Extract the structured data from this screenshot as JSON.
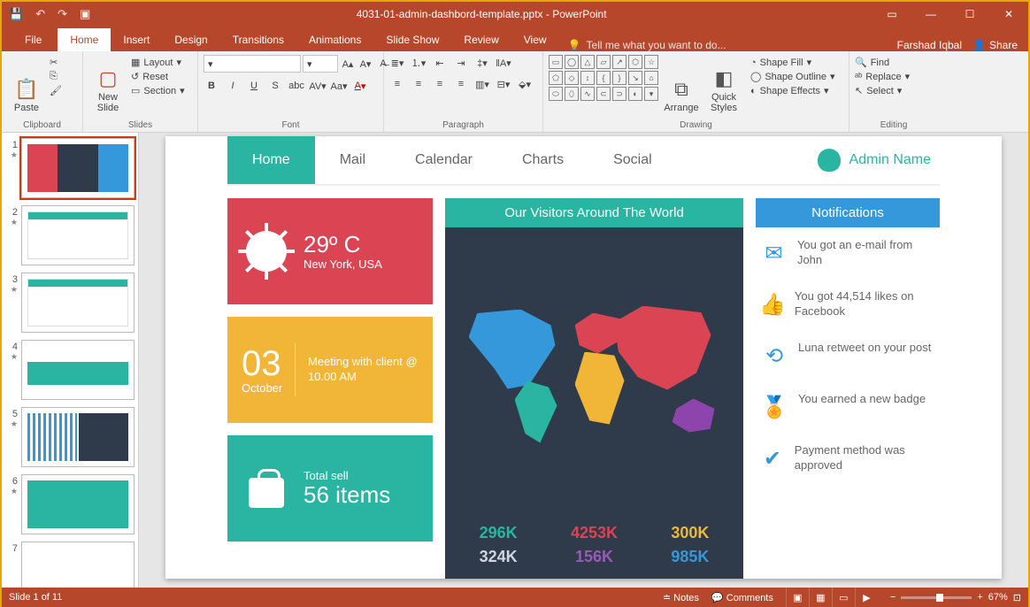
{
  "title": "4031-01-admin-dashbord-template.pptx - PowerPoint",
  "user": "Farshad Iqbal",
  "share": "Share",
  "ribbonTabs": {
    "file": "File",
    "home": "Home",
    "insert": "Insert",
    "design": "Design",
    "transitions": "Transitions",
    "animations": "Animations",
    "slideshow": "Slide Show",
    "review": "Review",
    "view": "View",
    "tell": "Tell me what you want to do..."
  },
  "groups": {
    "clipboard": {
      "label": "Clipboard",
      "paste": "Paste",
      "cut": "Cut",
      "copy": "Copy",
      "painter": "Format Painter"
    },
    "slides": {
      "label": "Slides",
      "new": "New\nSlide",
      "layout": "Layout",
      "reset": "Reset",
      "section": "Section"
    },
    "font": {
      "label": "Font"
    },
    "paragraph": {
      "label": "Paragraph"
    },
    "drawing": {
      "label": "Drawing",
      "arrange": "Arrange",
      "quick": "Quick\nStyles",
      "fill": "Shape Fill",
      "outline": "Shape Outline",
      "effects": "Shape Effects"
    },
    "editing": {
      "label": "Editing",
      "find": "Find",
      "replace": "Replace",
      "select": "Select"
    }
  },
  "thumbs": {
    "count": 11,
    "selected": 1
  },
  "slide": {
    "nav": {
      "home": "Home",
      "mail": "Mail",
      "calendar": "Calendar",
      "charts": "Charts",
      "social": "Social",
      "admin": "Admin Name"
    },
    "weather": {
      "temp": "29º C",
      "loc": "New York, USA"
    },
    "meeting": {
      "day": "03",
      "month": "October",
      "text": "Meeting with client @ 10.00 AM"
    },
    "sell": {
      "label": "Total sell",
      "value": "56 items"
    },
    "visitors": {
      "title": "Our Visitors Around The World",
      "stats": [
        "296K",
        "4253K",
        "300K",
        "324K",
        "156K",
        "985K"
      ]
    },
    "notifications": {
      "title": "Notifications",
      "items": [
        "You got an e-mail from John",
        "You got 44,514 likes on Facebook",
        "Luna retweet on your post",
        "You earned a new badge",
        "Payment method was approved"
      ]
    }
  },
  "status": {
    "slide": "Slide 1 of 11",
    "notes": "Notes",
    "comments": "Comments",
    "zoom": "67%"
  }
}
